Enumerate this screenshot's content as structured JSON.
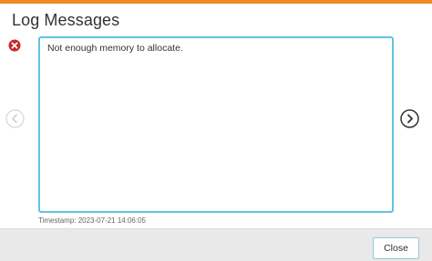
{
  "dialog": {
    "title": "Log Messages",
    "message": "Not enough memory to allocate.",
    "timestamp": "Timestamp: 2023-07-21 14:06:05",
    "close_label": "Close",
    "icons": {
      "status": "error-icon",
      "previous": "chevron-left-circle-icon",
      "next": "chevron-right-circle-icon"
    },
    "colors": {
      "accent_bar": "#f08a24",
      "error": "#c62828",
      "focus_border": "#5fc4e0"
    }
  }
}
